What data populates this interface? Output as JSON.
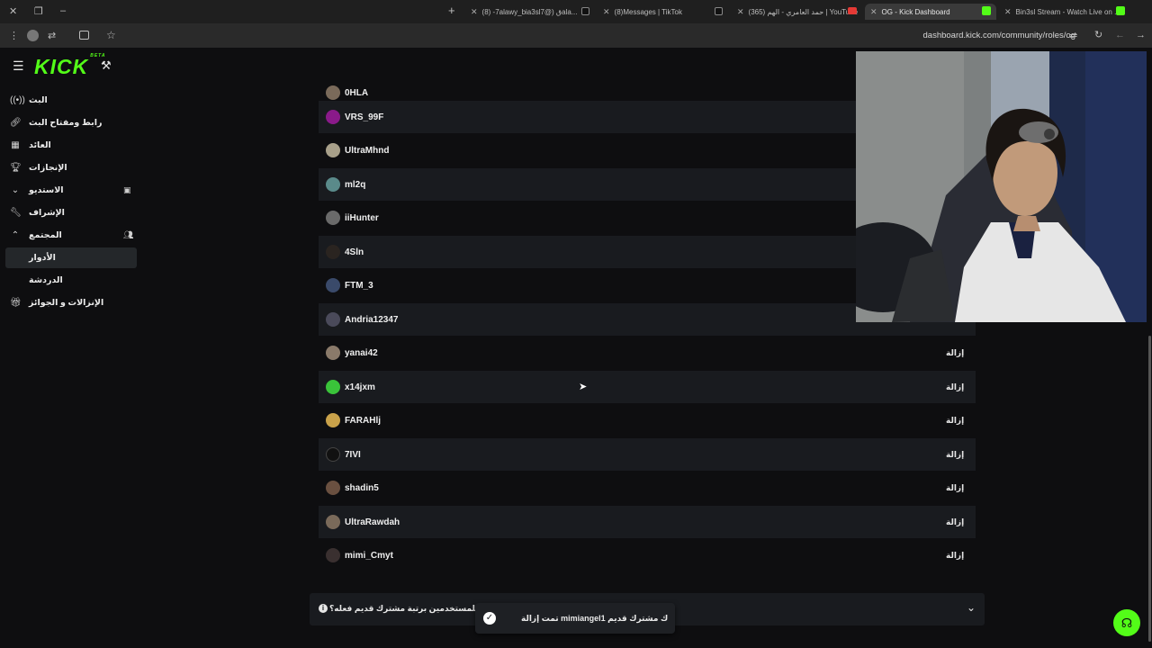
{
  "browser": {
    "tabs": [
      {
        "label": "(8) -7alawy_bia3slق (@7ala...",
        "favicon_color": "#111111",
        "active": false
      },
      {
        "label": "(8)Messages | TikTok",
        "favicon_color": "#111111",
        "active": false
      },
      {
        "label": "(365) حمد العامري - الهم | YouTube",
        "favicon_color": "#e53935",
        "active": false
      },
      {
        "label": "OG - Kick Dashboard",
        "favicon_color": "#53fc18",
        "active": true
      },
      {
        "label": "Bin3sl Stream - Watch Live on ...",
        "favicon_color": "#53fc18",
        "active": false
      }
    ],
    "url": "dashboard.kick.com/community/roles/og"
  },
  "app": {
    "logo": "KICK",
    "logo_badge": "BETA",
    "accent": "#53fc18"
  },
  "sidebar": {
    "items": [
      {
        "label": "البث",
        "icon": "broadcast-icon"
      },
      {
        "label": "رابط ومفتاح البث",
        "icon": "link-icon"
      },
      {
        "label": "العائد",
        "icon": "chart-icon"
      },
      {
        "label": "الإنجازات",
        "icon": "trophy-icon"
      },
      {
        "label": "الاستديو",
        "icon": "chevron-down-icon"
      },
      {
        "label": "الإشراف",
        "icon": "wrench-icon"
      },
      {
        "label": "المجتمع",
        "icon": "chevron-up-icon"
      },
      {
        "label": "الأدوار",
        "icon": ""
      },
      {
        "label": "الدردشة",
        "icon": ""
      },
      {
        "label": "الإنزالات و الجوائز",
        "icon": "gift-icon"
      }
    ]
  },
  "users": [
    {
      "name": "0HLA",
      "remove": ""
    },
    {
      "name": "VRS_99F",
      "remove": ""
    },
    {
      "name": "UltraMhnd",
      "remove": ""
    },
    {
      "name": "ml2q",
      "remove": ""
    },
    {
      "name": "iiHunter",
      "remove": ""
    },
    {
      "name": "4Sln",
      "remove": ""
    },
    {
      "name": "FTM_3",
      "remove": ""
    },
    {
      "name": "Andria12347",
      "remove": ""
    },
    {
      "name": "yanai42",
      "remove": "إزالة"
    },
    {
      "name": "x14jxm",
      "remove": "إزالة"
    },
    {
      "name": "FARAHlj",
      "remove": "إزالة"
    },
    {
      "name": "7IVI",
      "remove": "إزالة"
    },
    {
      "name": "shadin5",
      "remove": "إزالة"
    },
    {
      "name": "UltraRawdah",
      "remove": "إزالة"
    },
    {
      "name": "mimi_Cmyt",
      "remove": "إزالة"
    }
  ],
  "faq": {
    "question": "ما يمكن للمستخدمين برتبة مشترك قديم فعله؟"
  },
  "toast": {
    "message": "تمت إزالة mimiangel1 ك مشترك قديم"
  }
}
